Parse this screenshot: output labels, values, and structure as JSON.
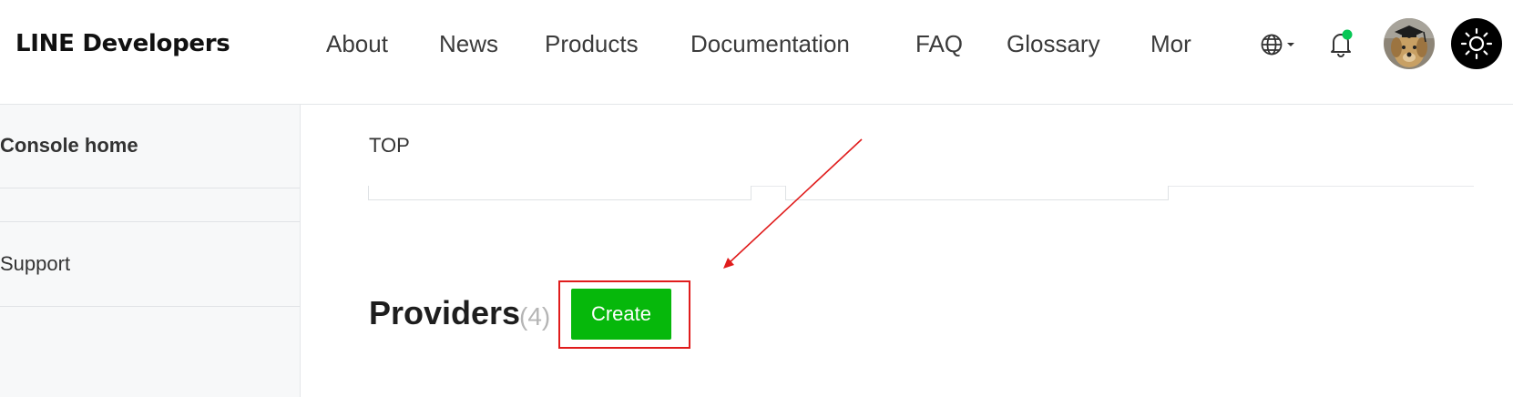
{
  "header": {
    "logo": "LINE Developers",
    "nav": [
      {
        "label": "About"
      },
      {
        "label": "News"
      },
      {
        "label": "Products"
      },
      {
        "label": "Documentation"
      },
      {
        "label": "FAQ"
      },
      {
        "label": "Glossary"
      },
      {
        "label": "More"
      }
    ],
    "icons": {
      "language": "globe-icon",
      "notifications": "bell-icon",
      "theme": "sun-icon"
    },
    "notification_dot_color": "#06c755"
  },
  "sidebar": {
    "items": [
      {
        "label": "Console home"
      },
      {
        "label": ""
      },
      {
        "label": "Support"
      }
    ]
  },
  "main": {
    "breadcrumb": "TOP",
    "providers": {
      "title": "Providers",
      "count": "(4)",
      "create_label": "Create"
    }
  },
  "annotation": {
    "color": "#e01c1c"
  },
  "colors": {
    "accent": "#06b80b"
  }
}
